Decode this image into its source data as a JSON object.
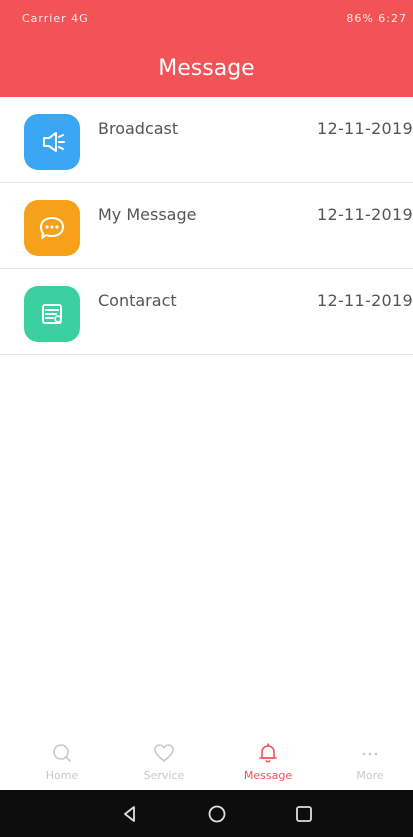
{
  "status_bar": {
    "left": "Carrier 4G",
    "right": "86% 6:27"
  },
  "header": {
    "title": "Message"
  },
  "messages": [
    {
      "label": "Broadcast",
      "date": "12-11-2019",
      "icon": "speaker-icon",
      "color": "#3aa6f4"
    },
    {
      "label": "My Message",
      "date": "12-11-2019",
      "icon": "chat-bubble-icon",
      "color": "#f6a11a"
    },
    {
      "label": "Contaract",
      "date": "12-11-2019",
      "icon": "document-icon",
      "color": "#3ccfa0"
    }
  ],
  "tabbar": {
    "home": "Home",
    "service": "Service",
    "message": "Message",
    "more": "More"
  },
  "colors": {
    "accent": "#f25357",
    "inactive": "#c8c8c8"
  }
}
